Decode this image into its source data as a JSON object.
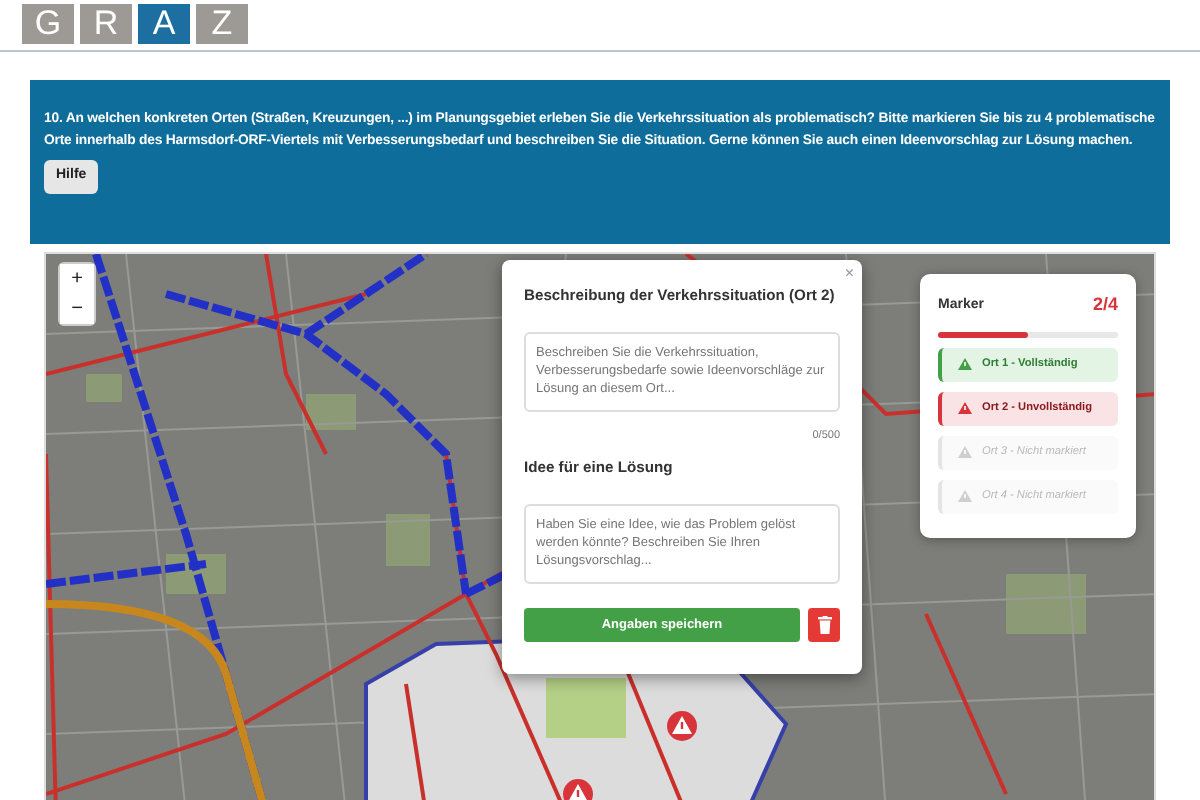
{
  "logo": {
    "letters": [
      {
        "text": "G",
        "highlighted": false
      },
      {
        "text": "R",
        "highlighted": false
      },
      {
        "text": "A",
        "highlighted": true
      },
      {
        "text": "Z",
        "highlighted": false
      }
    ]
  },
  "question": {
    "text": "10. An welchen konkreten Orten (Straßen, Kreuzungen, ...) im Planungsgebiet erleben Sie die Verkehrssituation als problematisch? Bitte markieren Sie bis zu 4 problematische Orte innerhalb des Harmsdorf-ORF-Viertels mit Verbesserungsbedarf und beschreiben Sie die Situation. Gerne können Sie auch einen Ideenvorschlag zur Lösung machen.",
    "help_button": "Hilfe"
  },
  "map": {
    "zoom_in": "+",
    "zoom_out": "−"
  },
  "popup": {
    "close": "×",
    "title": "Beschreibung der Verkehrssituation (Ort 2)",
    "description": {
      "placeholder": "Beschreiben Sie die Verkehrssituation, Verbesserungsbedarfe sowie Ideenvorschläge zur Lösung an diesem Ort..."
    },
    "counter": "0/500",
    "idea_title": "Idee für eine Lösung",
    "idea": {
      "placeholder": "Haben Sie eine Idee, wie das Problem gelöst werden könnte? Beschreiben Sie Ihren Lösungsvorschlag..."
    },
    "save_button": "Angaben speichern"
  },
  "marker_panel": {
    "title": "Marker",
    "count": "2/4",
    "level": 0.5,
    "items": [
      {
        "label": "Ort 1 - Vollständig",
        "kind": "complete"
      },
      {
        "label": "Ort 2 - Unvollständig",
        "kind": "incomplete"
      },
      {
        "label": "Ort 3 - Nicht markiert",
        "kind": "unmarked"
      },
      {
        "label": "Ort 4 - Nicht markiert",
        "kind": "unmarked"
      }
    ]
  }
}
